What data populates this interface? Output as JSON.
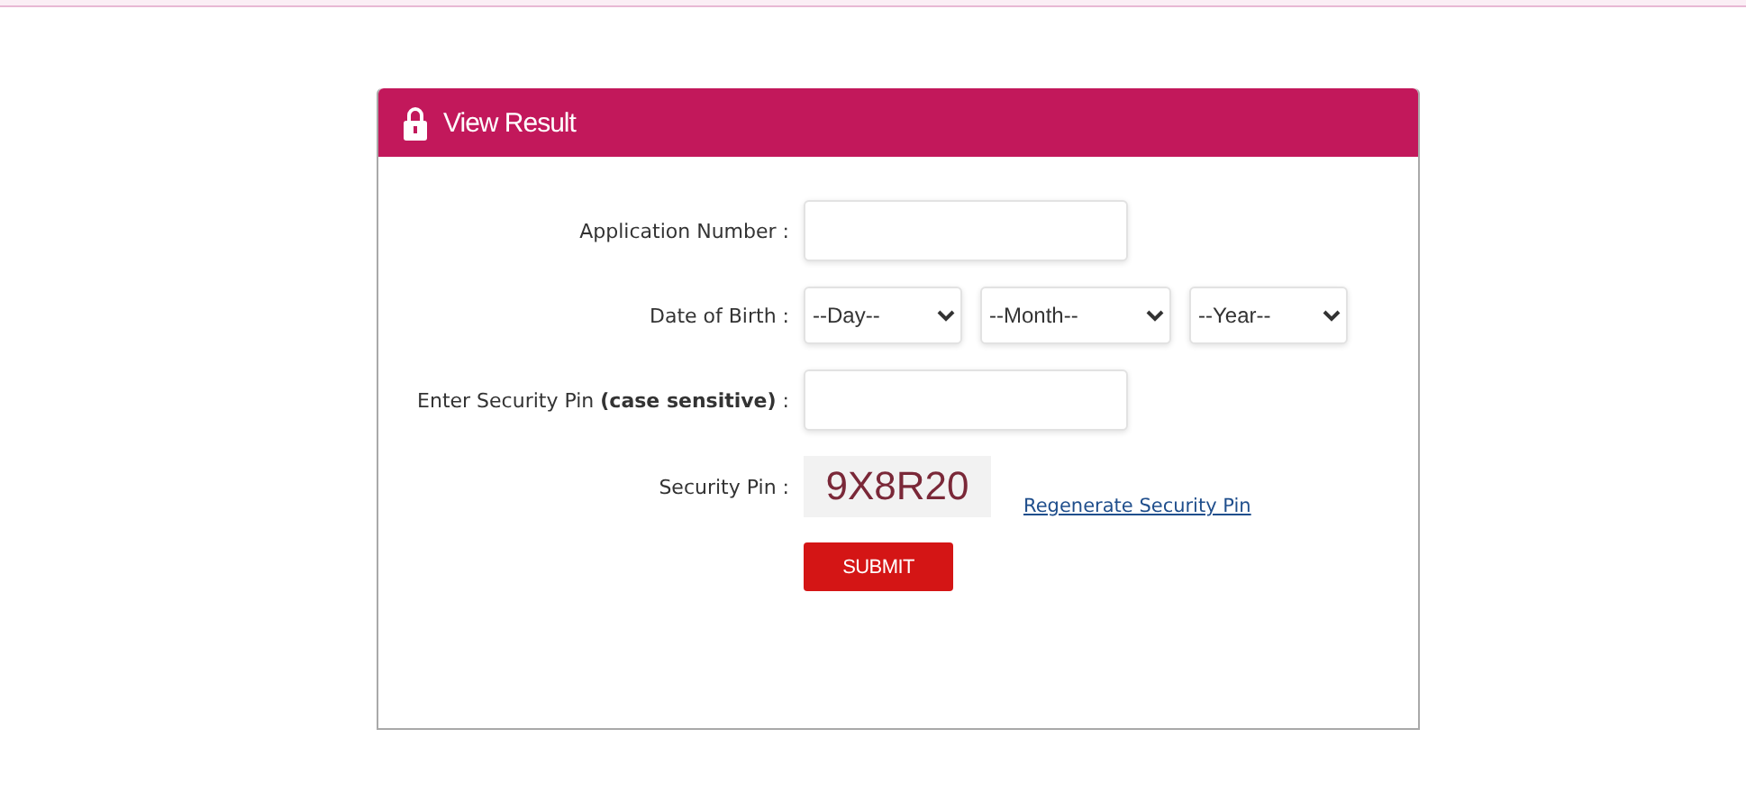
{
  "panel": {
    "title": "View Result"
  },
  "fields": [
    {
      "kind": "text",
      "label": "Application Number :"
    },
    {
      "kind": "selects",
      "label": "Date of Birth :",
      "options": [
        "--Day--",
        "--Month--",
        "--Year--"
      ]
    },
    {
      "kind": "text",
      "label": "Enter Security Pin **(case sensitive)** :"
    },
    {
      "kind": "captcha",
      "label": "Security Pin :",
      "code": "9X8R20",
      "link": "Regenerate Security Pin"
    }
  ],
  "submit": "SUBMIT"
}
